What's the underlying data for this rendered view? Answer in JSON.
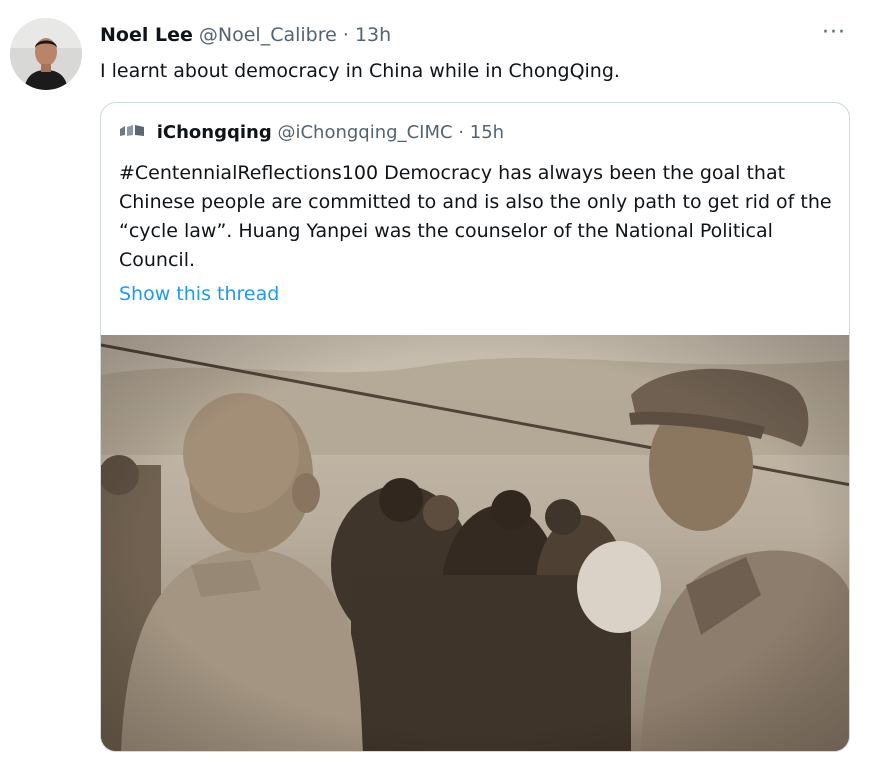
{
  "tweet": {
    "display_name": "Noel Lee",
    "handle": "@Noel_Calibre",
    "separator": "·",
    "time": "13h",
    "more": "···",
    "text": "I learnt about democracy in China while in ChongQing."
  },
  "quoted_tweet": {
    "display_name": "iChongqing",
    "handle": "@iChongqing_CIMC",
    "separator": "·",
    "time": "15h",
    "text": "#CentennialReflections100  Democracy has always been the goal that Chinese people are committed to and is also the only path to get rid of the “cycle law”. Huang Yanpei was the counselor of the National Political Council.",
    "show_thread": "Show this thread"
  },
  "colors": {
    "secondary_text": "#536471",
    "link": "#1d9bf0",
    "border": "#cfd9de"
  }
}
